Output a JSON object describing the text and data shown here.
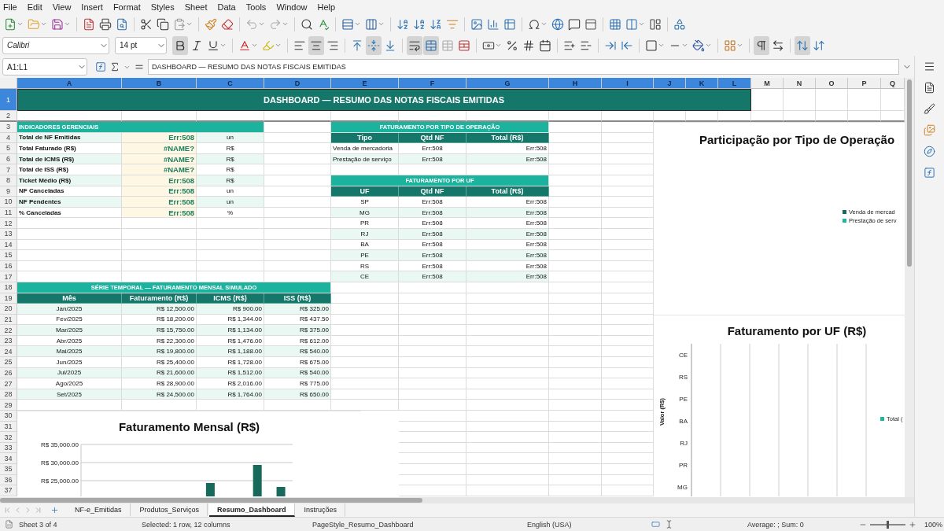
{
  "menu": [
    "File",
    "Edit",
    "View",
    "Insert",
    "Format",
    "Styles",
    "Sheet",
    "Data",
    "Tools",
    "Window",
    "Help"
  ],
  "font_name": {
    "value": "Calibri"
  },
  "font_size": {
    "value": "14 pt"
  },
  "format_toolbar": [
    {
      "kind": "bold",
      "on": true
    },
    {
      "kind": "italic",
      "on": false
    },
    {
      "kind": "underline",
      "on": false
    },
    {
      "kind": "font-color",
      "on": false
    },
    {
      "kind": "highlight",
      "on": false
    },
    {
      "kind": "align-left",
      "on": false
    },
    {
      "kind": "align-center",
      "on": true
    },
    {
      "kind": "align-right",
      "on": false
    },
    {
      "kind": "align-top",
      "on": false
    },
    {
      "kind": "align-middle",
      "on": true
    },
    {
      "kind": "align-bottom",
      "on": false
    },
    {
      "kind": "wrap",
      "on": true
    },
    {
      "kind": "merge-center",
      "on": true
    },
    {
      "kind": "merge",
      "on": false
    },
    {
      "kind": "unmerge",
      "on": false
    },
    {
      "kind": "currency",
      "on": false
    },
    {
      "kind": "percent",
      "on": false
    },
    {
      "kind": "decimal",
      "on": false
    },
    {
      "kind": "date",
      "on": false
    },
    {
      "kind": "add-decimal",
      "on": false
    },
    {
      "kind": "remove-decimal",
      "on": false
    },
    {
      "kind": "indent",
      "on": false
    },
    {
      "kind": "outdent",
      "on": false
    },
    {
      "kind": "borders",
      "on": false
    },
    {
      "kind": "border-style",
      "on": false
    },
    {
      "kind": "border-color",
      "on": false
    },
    {
      "kind": "conditional",
      "on": false
    },
    {
      "kind": "ltr",
      "on": true
    },
    {
      "kind": "rtl",
      "on": false
    },
    {
      "kind": "vertical",
      "on": true
    },
    {
      "kind": "sort-vertical",
      "on": false
    }
  ],
  "formula_bar": {
    "name_box": "A1:L1",
    "content": "DASHBOARD — RESUMO DAS NOTAS FISCAIS EMITIDAS"
  },
  "columns": [
    {
      "label": "A",
      "selected": true
    },
    {
      "label": "B",
      "selected": true
    },
    {
      "label": "C",
      "selected": true
    },
    {
      "label": "D",
      "selected": true
    },
    {
      "label": "E",
      "selected": true
    },
    {
      "label": "F",
      "selected": true
    },
    {
      "label": "G",
      "selected": true
    },
    {
      "label": "H",
      "selected": true
    },
    {
      "label": "I",
      "selected": true
    },
    {
      "label": "J",
      "selected": true
    },
    {
      "label": "K",
      "selected": true
    },
    {
      "label": "L",
      "selected": true
    },
    {
      "label": "M",
      "selected": false
    },
    {
      "label": "N",
      "selected": false
    },
    {
      "label": "O",
      "selected": false
    },
    {
      "label": "P",
      "selected": false
    },
    {
      "label": "Q",
      "selected": false
    }
  ],
  "row_headers": [
    {
      "label": "1",
      "selected": true
    },
    {
      "label": "2",
      "selected": false
    },
    {
      "label": "3",
      "selected": false
    },
    {
      "label": "4",
      "selected": false
    },
    {
      "label": "5",
      "selected": false
    },
    {
      "label": "6",
      "selected": false
    },
    {
      "label": "7",
      "selected": false
    },
    {
      "label": "8",
      "selected": false
    },
    {
      "label": "9",
      "selected": false
    },
    {
      "label": "10",
      "selected": false
    },
    {
      "label": "11",
      "selected": false
    },
    {
      "label": "12",
      "selected": false
    },
    {
      "label": "13",
      "selected": false
    },
    {
      "label": "14",
      "selected": false
    },
    {
      "label": "15",
      "selected": false
    },
    {
      "label": "16",
      "selected": false
    },
    {
      "label": "17",
      "selected": false
    },
    {
      "label": "18",
      "selected": false
    },
    {
      "label": "19",
      "selected": false
    },
    {
      "label": "20",
      "selected": false
    },
    {
      "label": "21",
      "selected": false
    },
    {
      "label": "22",
      "selected": false
    },
    {
      "label": "23",
      "selected": false
    },
    {
      "label": "24",
      "selected": false
    },
    {
      "label": "25",
      "selected": false
    },
    {
      "label": "26",
      "selected": false
    },
    {
      "label": "27",
      "selected": false
    },
    {
      "label": "28",
      "selected": false
    },
    {
      "label": "29",
      "selected": false
    },
    {
      "label": "30",
      "selected": false
    },
    {
      "label": "31",
      "selected": false
    },
    {
      "label": "32",
      "selected": false
    },
    {
      "label": "33",
      "selected": false
    },
    {
      "label": "34",
      "selected": false
    },
    {
      "label": "35",
      "selected": false
    },
    {
      "label": "36",
      "selected": false
    },
    {
      "label": "37",
      "selected": false
    }
  ],
  "title": "DASHBOARD — RESUMO DAS NOTAS FISCAIS EMITIDAS",
  "indicators": {
    "title": "INDICADORES GERENCIAIS",
    "rows": [
      {
        "label": "Total de NF Emitidas",
        "value": "Err:508",
        "unit": "un"
      },
      {
        "label": "Total Faturado (R$)",
        "value": "#NAME?",
        "unit": "R$"
      },
      {
        "label": "Total de ICMS (R$)",
        "value": "#NAME?",
        "unit": "R$"
      },
      {
        "label": "Total de ISS (R$)",
        "value": "#NAME?",
        "unit": "R$"
      },
      {
        "label": "Ticket Médio (R$)",
        "value": "Err:508",
        "unit": "R$"
      },
      {
        "label": "NF Canceladas",
        "value": "Err:508",
        "unit": "un"
      },
      {
        "label": "NF Pendentes",
        "value": "Err:508",
        "unit": "un"
      },
      {
        "label": "% Canceladas",
        "value": "Err:508",
        "unit": "%"
      }
    ]
  },
  "operation_table": {
    "title": "FATURAMENTO POR TIPO DE OPERAÇÃO",
    "columns": [
      "Tipo",
      "Qtd NF",
      "Total (R$)"
    ],
    "rows": [
      [
        "Venda de mercadoria",
        "Err:508",
        "Err:508"
      ],
      [
        "Prestação de serviço",
        "Err:508",
        "Err:508"
      ]
    ]
  },
  "uf_table": {
    "title": "FATURAMENTO POR UF",
    "columns": [
      "UF",
      "Qtd NF",
      "Total (R$)"
    ],
    "rows": [
      [
        "SP",
        "Err:508",
        "Err:508"
      ],
      [
        "MG",
        "Err:508",
        "Err:508"
      ],
      [
        "PR",
        "Err:508",
        "Err:508"
      ],
      [
        "RJ",
        "Err:508",
        "Err:508"
      ],
      [
        "BA",
        "Err:508",
        "Err:508"
      ],
      [
        "PE",
        "Err:508",
        "Err:508"
      ],
      [
        "RS",
        "Err:508",
        "Err:508"
      ],
      [
        "CE",
        "Err:508",
        "Err:508"
      ]
    ]
  },
  "monthly_table": {
    "title": "SÉRIE TEMPORAL — FATURAMENTO MENSAL SIMULADO",
    "columns": [
      "Mês",
      "Faturamento (R$)",
      "ICMS (R$)",
      "ISS (R$)"
    ],
    "rows": [
      [
        "Jan/2025",
        "R$ 12,500.00",
        "R$ 900.00",
        "R$ 325.00"
      ],
      [
        "Fev/2025",
        "R$ 18,200.00",
        "R$ 1,344.00",
        "R$ 437.50"
      ],
      [
        "Mar/2025",
        "R$ 15,750.00",
        "R$ 1,134.00",
        "R$ 375.00"
      ],
      [
        "Abr/2025",
        "R$ 22,300.00",
        "R$ 1,476.00",
        "R$ 612.00"
      ],
      [
        "Mai/2025",
        "R$ 19,800.00",
        "R$ 1,188.00",
        "R$ 540.00"
      ],
      [
        "Jun/2025",
        "R$ 25,400.00",
        "R$ 1,728.00",
        "R$ 675.00"
      ],
      [
        "Jul/2025",
        "R$ 21,600.00",
        "R$ 1,512.00",
        "R$ 540.00"
      ],
      [
        "Ago/2025",
        "R$ 28,900.00",
        "R$ 2,016.00",
        "R$ 775.00"
      ],
      [
        "Set/2025",
        "R$ 24,500.00",
        "R$ 1,764.00",
        "R$ 650.00"
      ]
    ]
  },
  "participation_chart": {
    "title": "Participação por Tipo de Operação",
    "legend": [
      {
        "label": "Venda de mercad",
        "color": "#17695c"
      },
      {
        "label": "Prestação de serv",
        "color": "#1fb59f"
      }
    ]
  },
  "uf_chart": {
    "title": "Faturamento por UF (R$)",
    "axis_title": "Valor (R$)",
    "categories": [
      "CE",
      "RS",
      "PE",
      "BA",
      "RJ",
      "PR",
      "MG"
    ],
    "legend": [
      {
        "label": "Total (",
        "color": "#1fb59f"
      }
    ]
  },
  "monthly_chart": {
    "title": "Faturamento Mensal (R$)",
    "axis_labels": [
      "R$ 35,000.00",
      "R$ 30,000.00",
      "R$ 25,000.00"
    ]
  },
  "sheet_tabs": [
    {
      "label": "NF-e_Emitidas",
      "selected": false
    },
    {
      "label": "Produtos_Serviços",
      "selected": false
    },
    {
      "label": "Resumo_Dashboard",
      "selected": true
    },
    {
      "label": "Instruções",
      "selected": false
    }
  ],
  "status_bar": {
    "sheet": "Sheet 3 of 4",
    "selection": "Selected: 1 row, 12 columns",
    "page_style": "PageStyle_Resumo_Dashboard",
    "language": "English (USA)",
    "summary": "Average: ; Sum: 0",
    "zoom": {
      "level": 0.5,
      "reading": "100%"
    }
  }
}
